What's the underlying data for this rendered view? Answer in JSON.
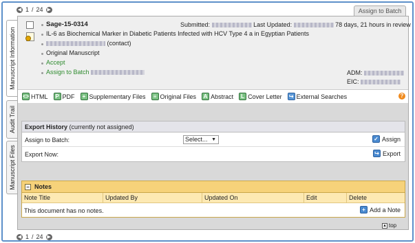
{
  "pager": {
    "current": "1",
    "total": "24",
    "separator": "/"
  },
  "assign_tab": "Assign to Batch",
  "side_tabs": [
    "Manuscript Information",
    "Audit Trail",
    "Manuscript Files"
  ],
  "manuscript": {
    "id": "Sage-15-0314",
    "title": "IL-6 as Biochemical Marker in Diabetic Patients Infected with HCV Type 4 a in Egyptian Patients",
    "contact_suffix": "(contact)",
    "original": "Original Manuscript",
    "accept": "Accept",
    "assign_batch": "Assign to Batch",
    "submitted_label": "Submitted:",
    "last_updated_label": "Last Updated:",
    "duration": "78 days, 21 hours in review",
    "adm_label": "ADM:",
    "eic_label": "EIC:"
  },
  "toolbar": [
    "HTML",
    "PDF",
    "Supplementary Files",
    "Original Files",
    "Abstract",
    "Cover Letter",
    "External Searches"
  ],
  "export": {
    "title": "Export History",
    "subtitle": "(currently not assigned)",
    "assign_label": "Assign to Batch:",
    "select_value": "Select...",
    "assign_button": "Assign",
    "export_label": "Export Now:",
    "export_button": "Export"
  },
  "notes": {
    "title": "Notes",
    "columns": [
      "Note Title",
      "Updated By",
      "Updated On",
      "Edit",
      "Delete"
    ],
    "empty_message": "This document has no notes.",
    "add_button": "Add a Note"
  },
  "top_link": "top",
  "icons": {
    "help": "help-icon",
    "toolbar": [
      "html-icon",
      "pdf-icon",
      "add-icon",
      "files-icon",
      "abstract-icon",
      "letter-icon",
      "search-icon"
    ]
  }
}
